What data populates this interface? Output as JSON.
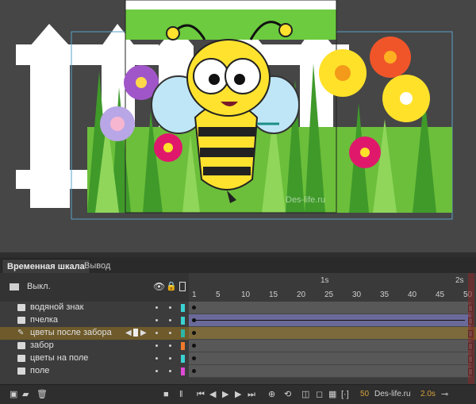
{
  "stage": {
    "watermark": "Des-life.ru"
  },
  "panel": {
    "tabs": [
      "Временная шкала",
      "Вывод"
    ],
    "header": {
      "off_label": "Выкл.",
      "eye_icon": "eye-icon",
      "lock_icon": "lock-icon",
      "outline_icon": "outline-icon"
    },
    "ruler": {
      "frame_numbers": [
        "1",
        "5",
        "10",
        "15",
        "20",
        "25",
        "30",
        "35",
        "40",
        "45",
        "50"
      ],
      "seconds": [
        "1s",
        "2s"
      ]
    },
    "layers": [
      {
        "name": "водяной знак",
        "color": "#3ad3d3",
        "selected": false
      },
      {
        "name": "пчелка",
        "color": "#3ad3d3",
        "selected": false,
        "tween": true
      },
      {
        "name": "цветы после забора",
        "color": "#2db5a8",
        "selected": true
      },
      {
        "name": "забор",
        "color": "#f07a2a",
        "selected": false
      },
      {
        "name": "цветы на поле",
        "color": "#3ad3d3",
        "selected": false
      },
      {
        "name": "поле",
        "color": "#e14ad6",
        "selected": false
      }
    ],
    "footer": {
      "fps": "50",
      "time": "2.0s",
      "frame_label": "Des-life.ru"
    }
  },
  "colors": {
    "selected_row": "#6e5a2a",
    "playhead": "#a33"
  }
}
